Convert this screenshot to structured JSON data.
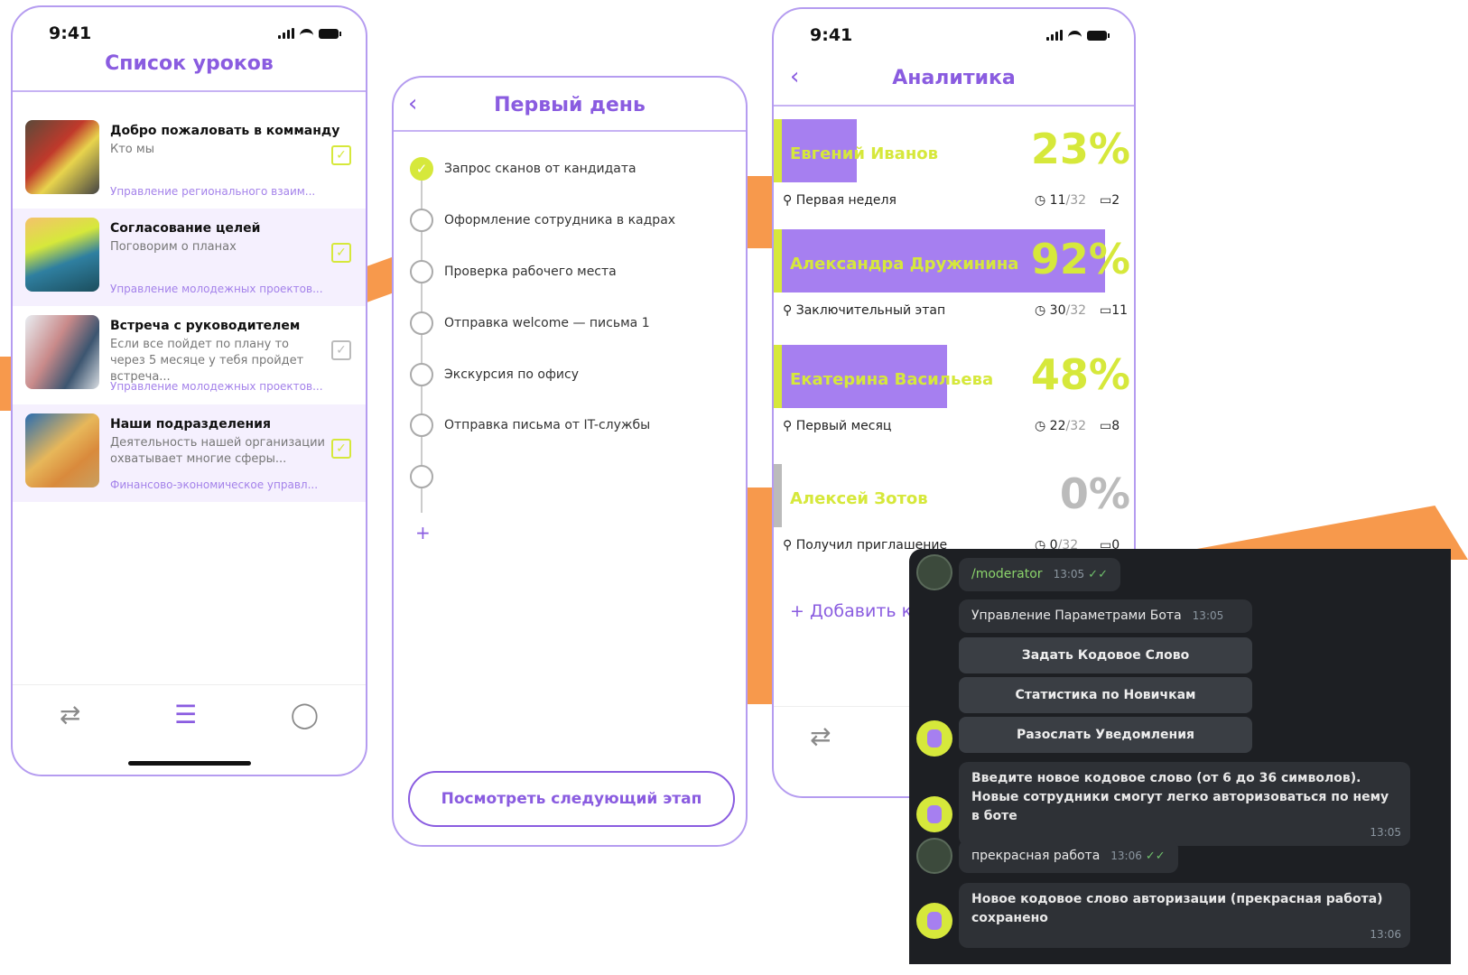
{
  "phone1": {
    "time": "9:41",
    "title": "Список уроков",
    "lessons": [
      {
        "title": "Добро пожаловать в комманду",
        "subtitle": "Кто мы",
        "dept": "Управление регионального взаим...",
        "checked": true
      },
      {
        "title": "Согласование целей",
        "subtitle": "Поговорим о планах",
        "dept": "Управление молодежных проектов...",
        "checked": true
      },
      {
        "title": "Встреча с руководителем",
        "subtitle": "Если все пойдет по плану то через 5 месяце у тебя пройдет встреча...",
        "dept": "Управление молодежных проектов...",
        "checked": false
      },
      {
        "title": "Наши подразделения",
        "subtitle": "Деятельность нашей организации охватывает многие сферы...",
        "dept": "Финансово-экономическое управл...",
        "checked": true
      }
    ],
    "nav_icons": [
      "routes-icon",
      "list-icon",
      "profile-icon"
    ]
  },
  "phone2": {
    "title": "Первый день",
    "steps": [
      {
        "label": "Запрос сканов от кандидата",
        "done": true
      },
      {
        "label": "Оформление сотрудника в кадрах",
        "done": false
      },
      {
        "label": "Проверка рабочего места",
        "done": false
      },
      {
        "label": "Отправка welcome — письма 1",
        "done": false
      },
      {
        "label": "Экскурсия по офису",
        "done": false
      },
      {
        "label": "Отправка письма от IT-службы",
        "done": false
      },
      {
        "label": "",
        "done": false
      }
    ],
    "add_symbol": "+",
    "next_button": "Посмотреть следующий этап"
  },
  "phone3": {
    "time": "9:41",
    "title": "Аналитика",
    "employees": [
      {
        "name": "Евгений Иванов",
        "percent": "23%",
        "progress": 0.23,
        "stage": "Первая неделя",
        "done": "11",
        "total": "/32",
        "messages": "2"
      },
      {
        "name": "Александра Дружинина",
        "percent": "92%",
        "progress": 0.92,
        "stage": "Заключительный этап",
        "done": "30",
        "total": "/32",
        "messages": "11"
      },
      {
        "name": "Екатерина Васильева",
        "percent": "48%",
        "progress": 0.48,
        "stage": "Первый месяц",
        "done": "22",
        "total": "/32",
        "messages": "8"
      },
      {
        "name": "Алексей Зотов",
        "percent": "0%",
        "progress": 0,
        "stage": "Получил приглашение",
        "done": "0",
        "total": "/32",
        "messages": "0"
      }
    ],
    "add_label": "+ Добавить ко"
  },
  "telegram": {
    "user_command": "/moderator",
    "user_command_time": "13:05",
    "bot_menu_title": "Управление Параметрами Бота",
    "bot_menu_time": "13:05",
    "buttons": [
      "Задать Кодовое Слово",
      "Статистика по Новичкам",
      "Разослать Уведомления"
    ],
    "bot_prompt": "Введите новое кодовое слово (от 6 до 36 символов). Новые сотрудники смогут легко авторизоваться по нему в боте",
    "bot_prompt_time": "13:05",
    "user_reply": "прекрасная работа",
    "user_reply_time": "13:06",
    "bot_confirm": "Новое кодовое слово авторизации (прекрасная работа) сохранено",
    "bot_confirm_time": "13:06"
  }
}
